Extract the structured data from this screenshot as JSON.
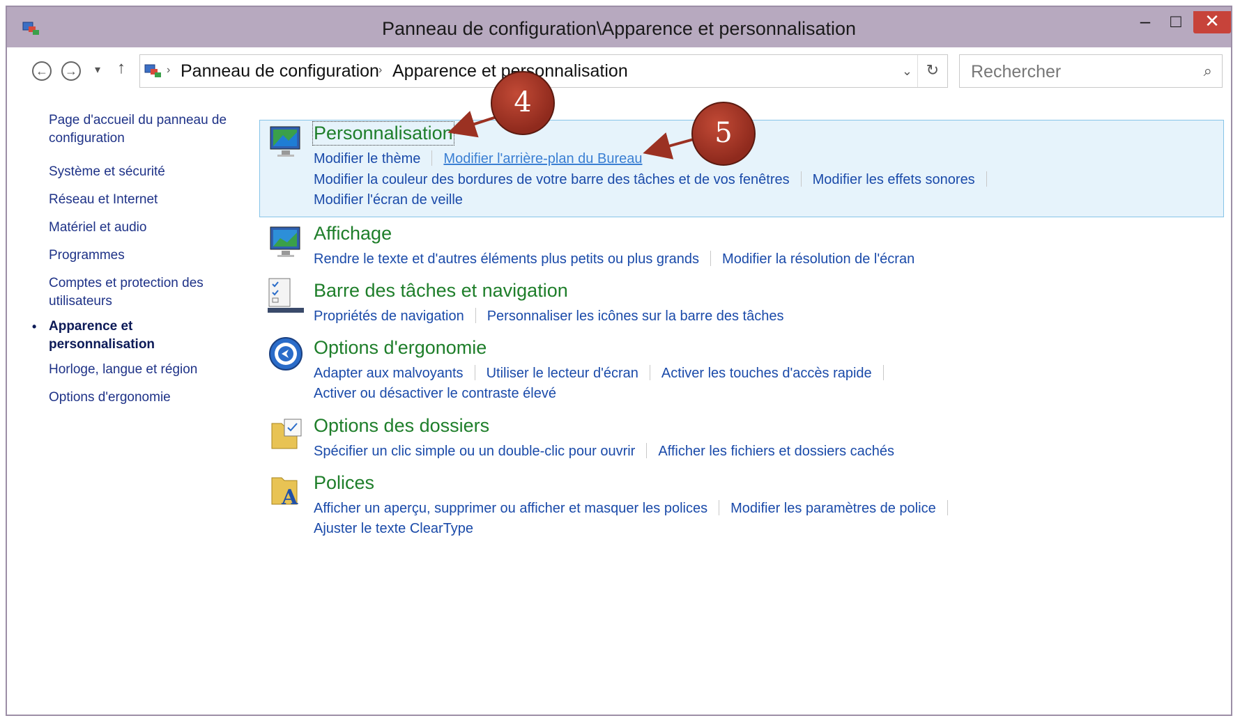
{
  "window": {
    "title": "Panneau de configuration\\Apparence et personnalisation",
    "minimize": "–",
    "maximize": "□",
    "close": "✕"
  },
  "navbar": {
    "back": "←",
    "forward": "→",
    "dropdown": "▾",
    "up": "↑",
    "breadcrumbs": [
      "Panneau de configuration",
      "Apparence et personnalisation"
    ],
    "separator": "›",
    "address_dropdown": "⌄",
    "refresh": "↻",
    "search_placeholder": "Rechercher",
    "search_icon": "⌕"
  },
  "sidebar": {
    "items": [
      {
        "label": "Page d'accueil du panneau de configuration"
      },
      {
        "label": "Système et sécurité"
      },
      {
        "label": "Réseau et Internet"
      },
      {
        "label": "Matériel et audio"
      },
      {
        "label": "Programmes"
      },
      {
        "label": "Comptes et protection des utilisateurs"
      },
      {
        "label": "Apparence et personnalisation",
        "active": true
      },
      {
        "label": "Horloge, langue et région"
      },
      {
        "label": "Options d'ergonomie"
      }
    ],
    "bullet": "•"
  },
  "categories": [
    {
      "title": "Personnalisation",
      "rows": [
        [
          "Modifier le thème",
          "Modifier l'arrière-plan du Bureau"
        ],
        [
          "Modifier la couleur des bordures de votre barre des tâches et de vos fenêtres",
          "Modifier les effets sonores"
        ],
        [
          "Modifier l'écran de veille"
        ]
      ]
    },
    {
      "title": "Affichage",
      "rows": [
        [
          "Rendre le texte et d'autres éléments plus petits ou plus grands",
          "Modifier la résolution de l'écran"
        ]
      ]
    },
    {
      "title": "Barre des tâches et navigation",
      "rows": [
        [
          "Propriétés de navigation",
          "Personnaliser les icônes sur la barre des tâches"
        ]
      ]
    },
    {
      "title": "Options d'ergonomie",
      "rows": [
        [
          "Adapter aux malvoyants",
          "Utiliser le lecteur d'écran",
          "Activer les touches d'accès rapide"
        ],
        [
          "Activer ou désactiver le contraste élevé"
        ]
      ]
    },
    {
      "title": "Options des dossiers",
      "rows": [
        [
          "Spécifier un clic simple ou un double-clic pour ouvrir",
          "Afficher les fichiers et dossiers cachés"
        ]
      ]
    },
    {
      "title": "Polices",
      "rows": [
        [
          "Afficher un aperçu, supprimer ou afficher et masquer les polices",
          "Modifier les paramètres de police"
        ],
        [
          "Ajuster le texte ClearType"
        ]
      ]
    }
  ],
  "annotations": {
    "callout_4": "4",
    "callout_5": "5",
    "accent_color": "#9b3122"
  }
}
